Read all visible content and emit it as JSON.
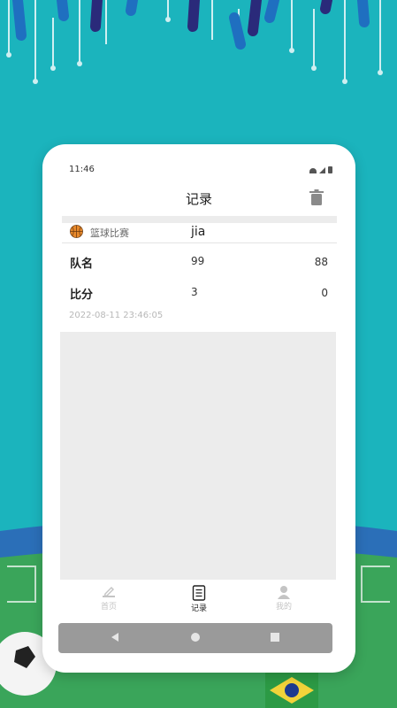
{
  "status_bar": {
    "time": "11:46"
  },
  "header": {
    "title": "记录"
  },
  "record": {
    "game_type": "篮球比赛",
    "game_name": "jia",
    "rows": [
      {
        "label": "队名",
        "team_a": "99",
        "team_b": "88"
      },
      {
        "label": "比分",
        "team_a": "3",
        "team_b": "0"
      }
    ],
    "timestamp": "2022-08-11 23:46:05"
  },
  "tabbar": {
    "items": [
      {
        "label": "首页",
        "icon": "edit-icon",
        "active": false
      },
      {
        "label": "记录",
        "icon": "list-icon",
        "active": true
      },
      {
        "label": "我的",
        "icon": "user-icon",
        "active": false
      }
    ]
  },
  "colors": {
    "background": "#1bb4bd",
    "card": "#ffffff",
    "basketball": "#e8892b",
    "tab_active": "#222222",
    "tab_inactive": "#c4c4c4"
  }
}
